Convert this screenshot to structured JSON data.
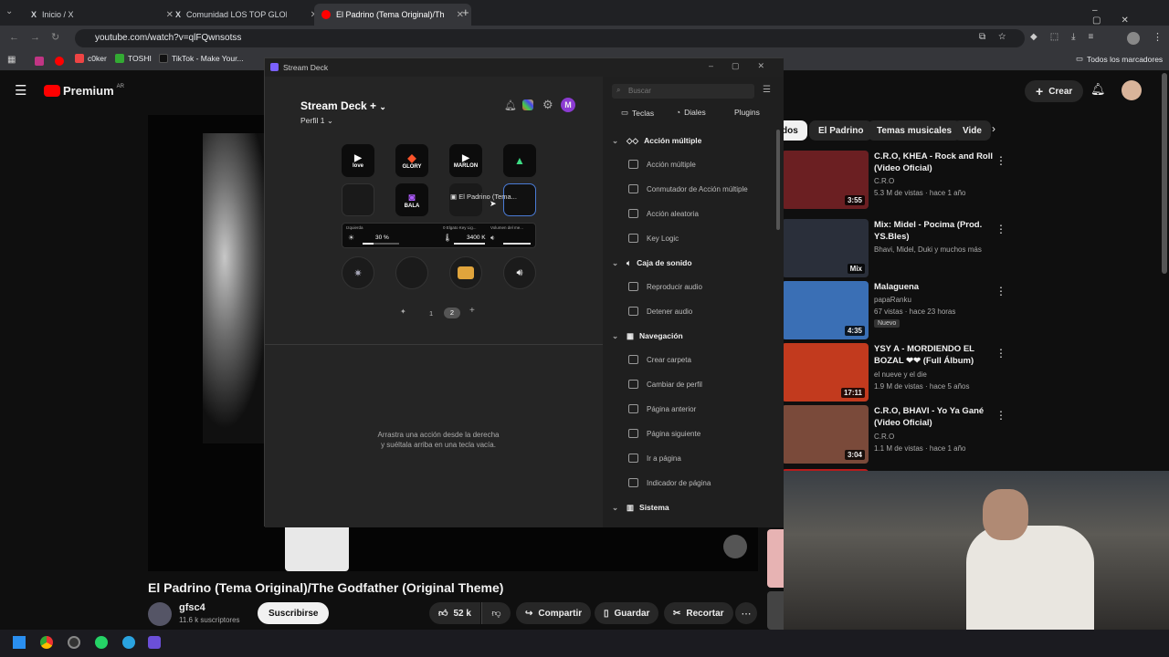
{
  "browser": {
    "tabs": [
      {
        "label": "Inicio / X",
        "icon": "x-logo-icon"
      },
      {
        "label": "Comunidad LOS TOP GLOBALES",
        "icon": "x-logo-icon"
      },
      {
        "label": "El Padrino (Tema Original)/The",
        "icon": "youtube-icon"
      }
    ],
    "url": "youtube.com/watch?v=qlFQwnsotss",
    "bookmarks": [
      "c0ker",
      "TOSHI",
      "TikTok - Make Your..."
    ],
    "all_bookmarks": "Todos los marcadores"
  },
  "youtube": {
    "logo": "Premium",
    "region": "AR",
    "create_label": "Crear",
    "chips": [
      "dos",
      "El Padrino",
      "Temas musicales",
      "Vide"
    ],
    "video_title": "El Padrino (Tema Original)/The Godfather (Original Theme)",
    "channel": "gfsc4",
    "subscribers": "11.6 k suscriptores",
    "subscribe_label": "Suscribirse",
    "likes": "52 k",
    "share_label": "Compartir",
    "save_label": "Guardar",
    "clip_label": "Recortar",
    "recommendations": [
      {
        "title": "C.R.O, KHEA - Rock and Roll (Video Oficial)",
        "channel": "C.R.O",
        "meta": "5.3 M de vistas · hace 1 año",
        "duration": "3:55",
        "color": "#6b1f22"
      },
      {
        "title": "Mix: Midel - Pocima (Prod. YS.Bles)",
        "channel": "Bhavi, Midel, Duki y muchos más",
        "meta": "",
        "duration": "Mix",
        "color": "#2a2f3a"
      },
      {
        "title": "Malaguena",
        "channel": "papaRanku",
        "meta": "67 vistas · hace 23 horas",
        "badge": "Nuevo",
        "duration": "4:35",
        "color": "#3a6fb5"
      },
      {
        "title": "YSY A - MORDIENDO EL BOZAL ❤❤ (Full Álbum)",
        "channel": "el nueve y el die",
        "meta": "1.9 M de vistas · hace 5 años",
        "duration": "17:11",
        "color": "#c23a1e"
      },
      {
        "title": "C.R.O, BHAVI - Yo Ya Gané (Video Oficial)",
        "channel": "C.R.O",
        "meta": "1.1 M de vistas · hace 1 año",
        "duration": "3:04",
        "color": "#7a4a3a"
      }
    ]
  },
  "streamdeck": {
    "window_title": "Stream Deck",
    "device": "Stream Deck +",
    "profile": "Perfil 1",
    "avatar": "M",
    "keys": [
      {
        "label": "love",
        "color": "#0c0c0c"
      },
      {
        "label": "GLORY",
        "color": "#0c0c0c"
      },
      {
        "label": "MARLON",
        "color": "#0c0c0c"
      },
      {
        "label": "",
        "color": "#0c0c0c"
      },
      {
        "label": "",
        "color": "#1a1a1a"
      },
      {
        "label": "BALA",
        "color": "#0c0c0c"
      },
      {
        "label": "",
        "color": "#1a1a1a"
      },
      {
        "label": "",
        "color": "#111111"
      }
    ],
    "drag_label": "El Padrino (Tema...",
    "strip": [
      {
        "name": "Izquierda",
        "value": "30 %"
      },
      {
        "name": "0 Elgato Key Lig...",
        "value": "3400 K"
      },
      {
        "name": "Volumen del me...",
        "value": ""
      }
    ],
    "pages": [
      "1",
      "2"
    ],
    "empty_hint_1": "Arrastra una acción desde la derecha",
    "empty_hint_2": "y suéltala arriba en una tecla vacía.",
    "search_placeholder": "Buscar",
    "tabs": [
      "Teclas",
      "Diales",
      "Plugins"
    ],
    "sections": [
      {
        "title": "Acción múltiple",
        "items": [
          "Acción múltiple",
          "Conmutador de Acción múltiple",
          "Acción aleatoria",
          "Key Logic"
        ]
      },
      {
        "title": "Caja de sonido",
        "items": [
          "Reproducir audio",
          "Detener audio"
        ]
      },
      {
        "title": "Navegación",
        "items": [
          "Crear carpeta",
          "Cambiar de perfil",
          "Página anterior",
          "Página siguiente",
          "Ir a página",
          "Indicador de página"
        ]
      },
      {
        "title": "Sistema",
        "items": []
      }
    ]
  }
}
